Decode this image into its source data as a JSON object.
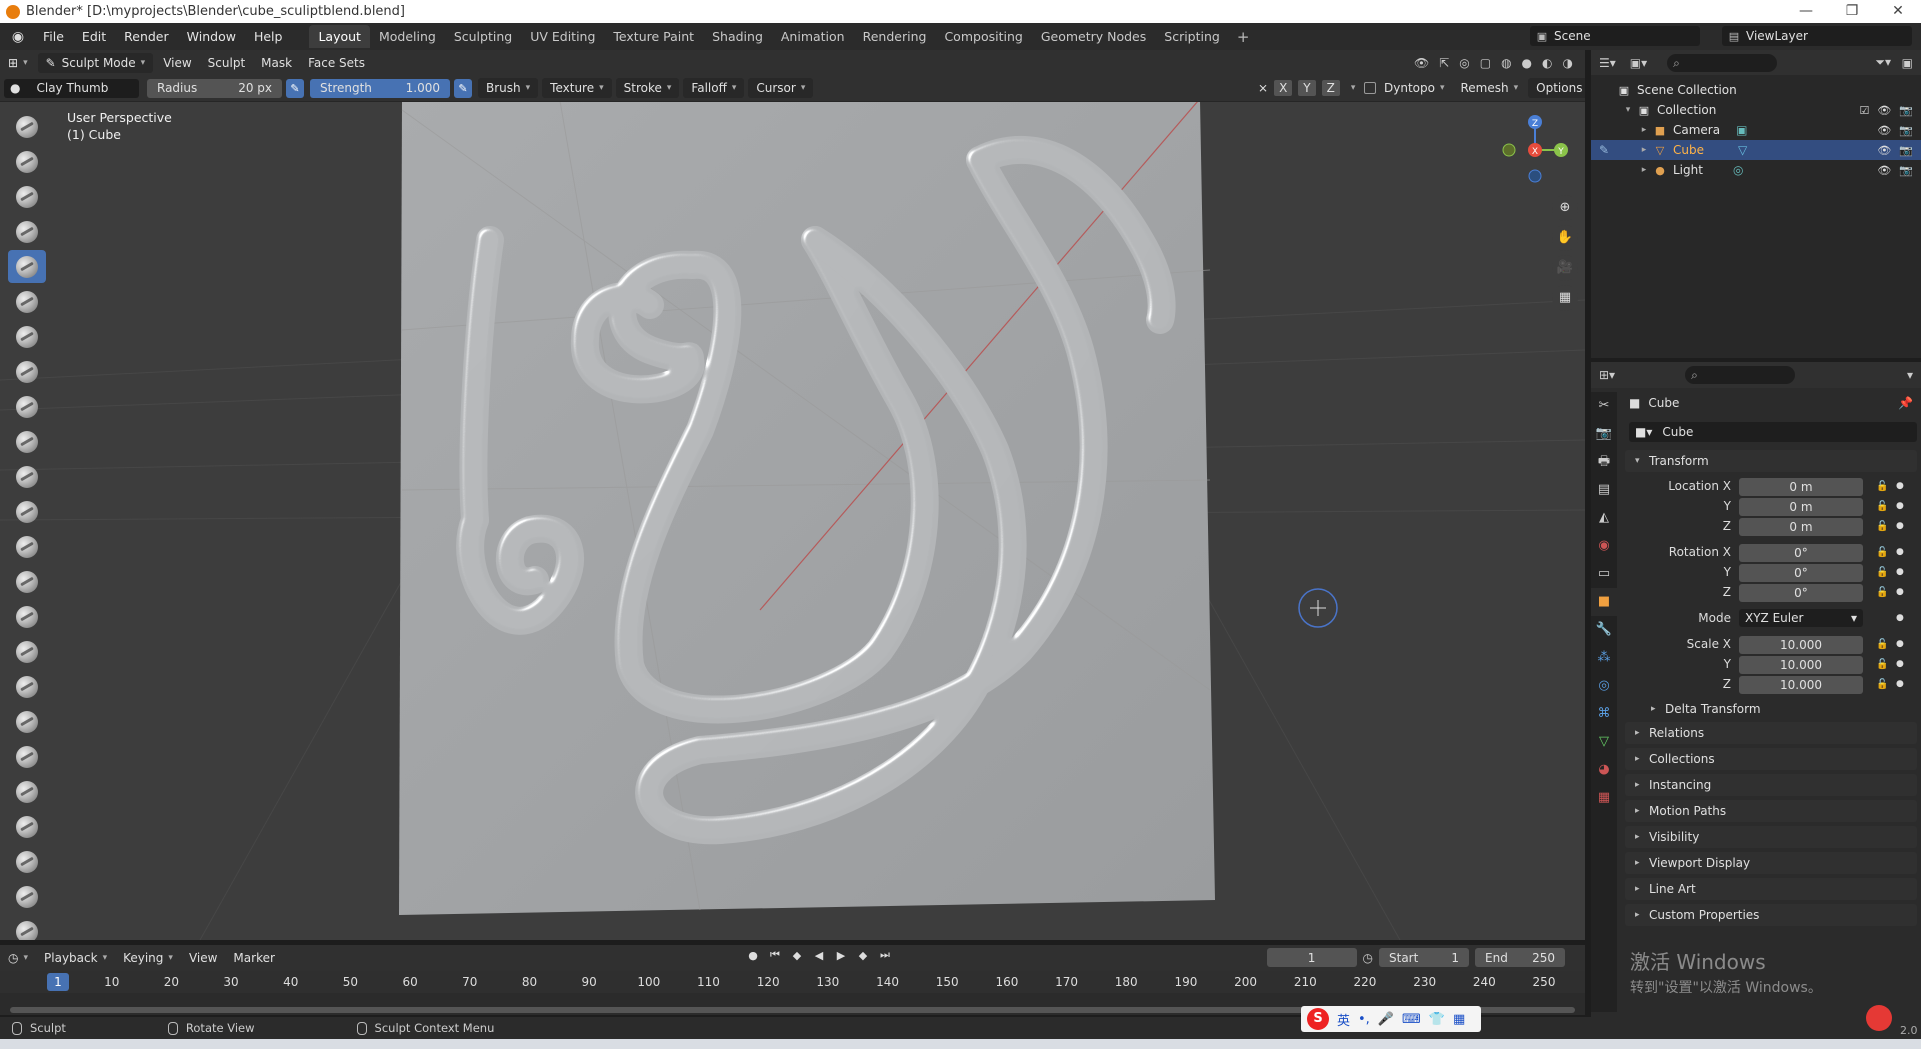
{
  "window": {
    "title": "Blender* [D:\\myprojects\\Blender\\cube_sculiptblend.blend]",
    "controls": [
      "—",
      "❐",
      "✕"
    ]
  },
  "menu": {
    "items": [
      "File",
      "Edit",
      "Render",
      "Window",
      "Help"
    ],
    "workspaces": [
      "Layout",
      "Modeling",
      "Sculpting",
      "UV Editing",
      "Texture Paint",
      "Shading",
      "Animation",
      "Rendering",
      "Compositing",
      "Geometry Nodes",
      "Scripting"
    ],
    "active_workspace": "Layout",
    "add_tab": "+",
    "scene": "Scene",
    "view_layer": "ViewLayer"
  },
  "viewport": {
    "mode": "Sculpt Mode",
    "menus": [
      "View",
      "Sculpt",
      "Mask",
      "Face Sets"
    ],
    "brush_name": "Clay Thumb",
    "radius_label": "Radius",
    "radius_value": "20 px",
    "strength_label": "Strength",
    "strength_value": "1.000",
    "tool_menus": [
      "Brush",
      "Texture",
      "Stroke",
      "Falloff",
      "Cursor"
    ],
    "axes": [
      "X",
      "Y",
      "Z"
    ],
    "right_menus": [
      "Dyntopo",
      "Remesh",
      "Options"
    ],
    "perspective": "User Perspective",
    "object": "(1) Cube",
    "gizmo": {
      "x": "X",
      "y": "Y",
      "z": "Z"
    }
  },
  "toolbar": {
    "tool_count": 24,
    "active_index": 4
  },
  "outliner": {
    "root": "Scene Collection",
    "items": [
      {
        "name": "Collection",
        "level": 1,
        "selected": false
      },
      {
        "name": "Camera",
        "level": 2,
        "selected": false
      },
      {
        "name": "Cube",
        "level": 2,
        "selected": true
      },
      {
        "name": "Light",
        "level": 2,
        "selected": false
      }
    ]
  },
  "properties": {
    "object_title": "Cube",
    "object_name": "Cube",
    "transform": {
      "title": "Transform",
      "location_label": "Location X",
      "location": [
        "0 m",
        "0 m",
        "0 m"
      ],
      "rotation_label": "Rotation X",
      "rotation": [
        "0°",
        "0°",
        "0°"
      ],
      "mode_label": "Mode",
      "mode": "XYZ Euler",
      "scale_label": "Scale X",
      "scale": [
        "10.000",
        "10.000",
        "10.000"
      ],
      "axis_y": "Y",
      "axis_z": "Z",
      "delta": "Delta Transform"
    },
    "panels": [
      "Relations",
      "Collections",
      "Instancing",
      "Motion Paths",
      "Visibility",
      "Viewport Display",
      "Line Art",
      "Custom Properties"
    ]
  },
  "timeline": {
    "menus": [
      "Playback",
      "Keying",
      "View",
      "Marker"
    ],
    "current_frame": "1",
    "start_label": "Start",
    "start": "1",
    "end_label": "End",
    "end": "250",
    "ticks": [
      "1",
      "10",
      "20",
      "30",
      "40",
      "50",
      "60",
      "70",
      "80",
      "90",
      "100",
      "110",
      "120",
      "130",
      "140",
      "150",
      "160",
      "170",
      "180",
      "190",
      "200",
      "210",
      "220",
      "230",
      "240",
      "250"
    ]
  },
  "status": {
    "items": [
      "Sculpt",
      "Rotate View",
      "Sculpt Context Menu"
    ],
    "version": "2.0"
  },
  "overlay": {
    "watermark_line1": "激活 Windows",
    "watermark_line2": "转到\"设置\"以激活 Windows。",
    "ime_label": "英"
  }
}
